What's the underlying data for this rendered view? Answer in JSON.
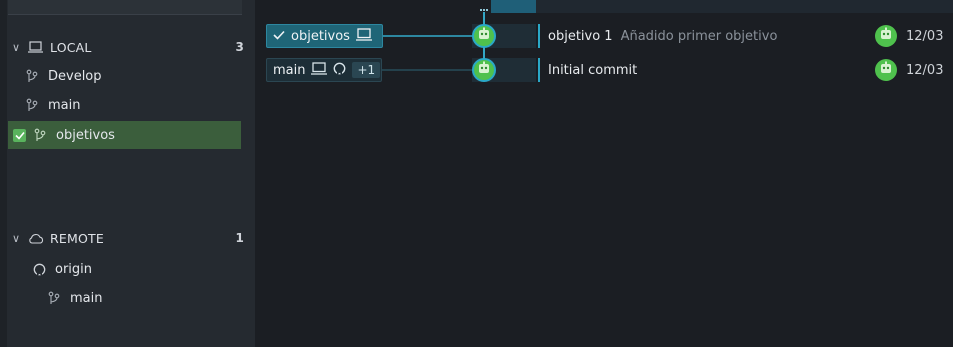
{
  "sidebar": {
    "local": {
      "label": "LOCAL",
      "count": "3",
      "icon": "laptop-icon"
    },
    "local_branches": [
      {
        "label": "Develop",
        "icon": "branch-icon",
        "active": false
      },
      {
        "label": "main",
        "icon": "branch-icon",
        "active": false
      },
      {
        "label": "objetivos",
        "icon": "branch-icon",
        "active": true
      }
    ],
    "remote": {
      "label": "REMOTE",
      "count": "1",
      "icon": "cloud-icon"
    },
    "remote_items": [
      {
        "label": "origin",
        "icon": "github-icon"
      },
      {
        "label": "main",
        "icon": "branch-icon"
      }
    ]
  },
  "graph": {
    "branch_labels": [
      {
        "label": "objetivos",
        "checked": true,
        "icons": [
          "laptop-icon"
        ]
      },
      {
        "label": "main",
        "icons": [
          "laptop-icon",
          "github-icon"
        ],
        "extra": "+1"
      }
    ]
  },
  "commits": [
    {
      "title": "objetivo 1",
      "description": "Añadido primer objetivo",
      "date": "12/03"
    },
    {
      "title": "Initial commit",
      "description": "",
      "date": "12/03"
    }
  ],
  "colors": {
    "accent": "#2aa8c7",
    "active_branch_bg": "#3b5e3c",
    "avatar_green": "#4fc14d",
    "sidebar_bg": "#252a30",
    "main_bg": "#1b1e23"
  }
}
